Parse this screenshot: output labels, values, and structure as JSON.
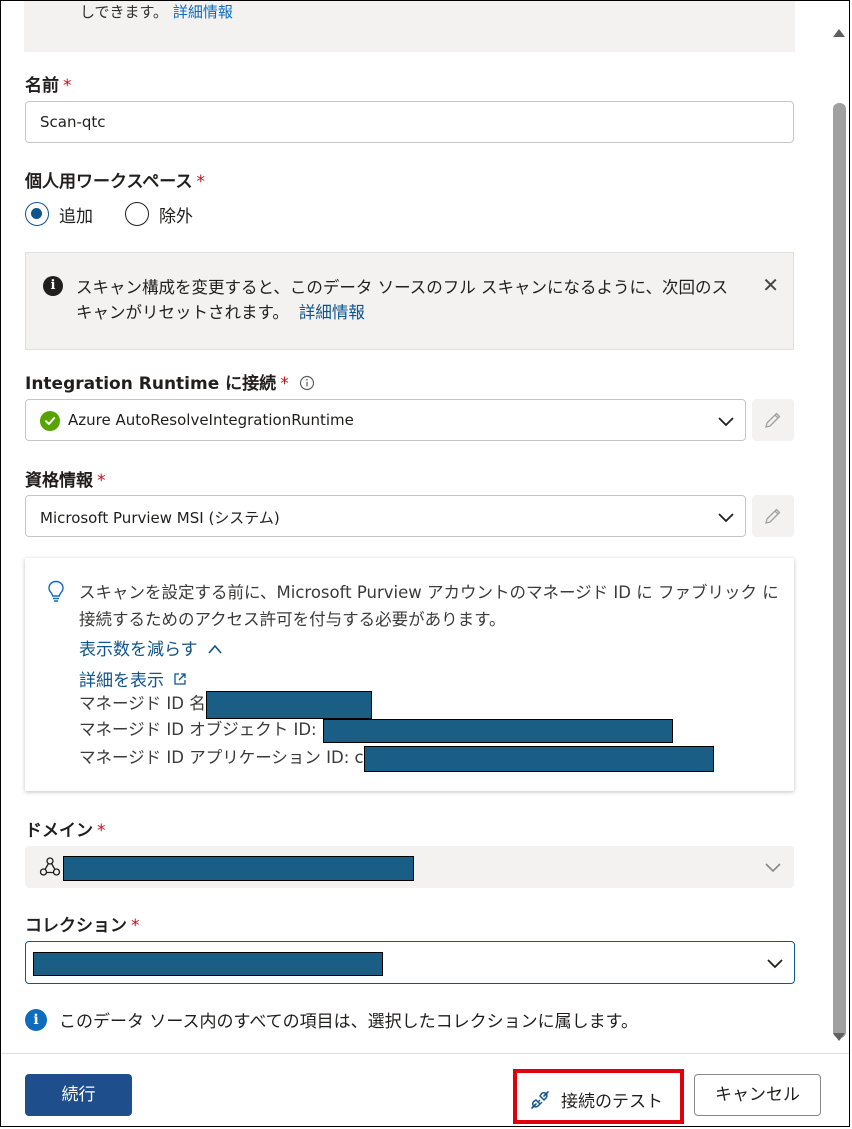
{
  "top_note": {
    "text": "しできます。",
    "link": "詳細情報"
  },
  "name": {
    "label": "名前",
    "required": "*",
    "value": "Scan-qtc"
  },
  "personal_workspace": {
    "label": "個人用ワークスペース",
    "required": "*",
    "options": [
      {
        "label": "追加",
        "selected": true
      },
      {
        "label": "除外",
        "selected": false
      }
    ]
  },
  "reset_info": {
    "text": "スキャン構成を変更すると、このデータ ソースのフル スキャンになるように、次回のスキャンがリセットされます。",
    "link": "詳細情報",
    "close": "✕"
  },
  "integration_runtime": {
    "label": "Integration Runtime に接続",
    "required": "*",
    "value": "Azure AutoResolveIntegrationRuntime"
  },
  "credential": {
    "label": "資格情報",
    "required": "*",
    "value": "Microsoft Purview MSI (システム)"
  },
  "msi_note": {
    "text": "スキャンを設定する前に、Microsoft Purview アカウントのマネージド ID に ファブリック に接続するためのアクセス許可を付与する必要があります。",
    "show_less": "表示数を減らす",
    "details": "詳細を表示",
    "rows": {
      "name": "マネージド ID 名",
      "object_id": "マネージド ID オブジェクト ID:",
      "app_id": "マネージド ID アプリケーション ID: c"
    }
  },
  "domain": {
    "label": "ドメイン",
    "required": "*"
  },
  "collection": {
    "label": "コレクション",
    "required": "*"
  },
  "collection_info": "このデータ ソース内のすべての項目は、選択したコレクションに属します。",
  "footer": {
    "continue": "続行",
    "test": "接続のテスト",
    "cancel": "キャンセル"
  },
  "colors": {
    "primary": "#1f4e8c",
    "required": "#c50f1f",
    "highlight": "#e0000b",
    "redaction": "#1a5e85"
  }
}
